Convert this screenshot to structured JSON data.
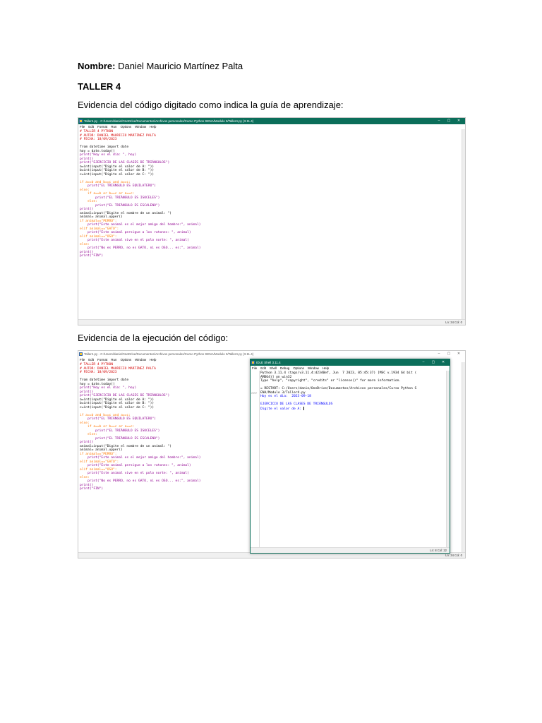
{
  "document": {
    "name_label": "Nombre:",
    "name_value": "Daniel Mauricio Martínez Palta",
    "taller": "TALLER 4",
    "evidence_code_heading": "Evidencia del código digitado como indica la guía de aprendizaje:",
    "evidence_exec_heading": "Evidencia de la ejecución del código:"
  },
  "editor": {
    "title": "Taller4.py - C:/Users/danie/OneDrive/Documentos/Archivos personales/Curso Python SENA/Modulo 3/Taller4.py (3.11.4)",
    "menu": [
      "File",
      "Edit",
      "Format",
      "Run",
      "Options",
      "Window",
      "Help"
    ],
    "status": "Ln: 34   Col: 0",
    "window_controls": [
      "–",
      "▢",
      "✕"
    ],
    "code_lines": [
      {
        "text": "# TALLER 4 PYTHON",
        "cls": "c-comment"
      },
      {
        "text": "# AUTOR: DANIEL MAURICIO MARTINEZ PALTA",
        "cls": "c-comment"
      },
      {
        "text": "# FECHA: 18/09/2023",
        "cls": "c-comment"
      },
      {
        "text": "",
        "cls": "c-def"
      },
      {
        "text": "from datetime import date",
        "cls": "c-def"
      },
      {
        "text": "hoy = date.today()",
        "cls": "c-def"
      },
      {
        "text": "print(\"Hoy es el dia: \", hoy)",
        "cls": "c-blt"
      },
      {
        "text": "print()",
        "cls": "c-blt"
      },
      {
        "text": "print(\"EJERCICIO DE LAS CLASES DE TRIÁNGULOS\")",
        "cls": "c-blt"
      },
      {
        "text": "a=int(input(\"Digite el valor de A: \"))",
        "cls": "c-def"
      },
      {
        "text": "b=int(input(\"Digite el valor de B: \"))",
        "cls": "c-def"
      },
      {
        "text": "c=int(input(\"Digite el valor de C: \"))",
        "cls": "c-def"
      },
      {
        "text": "",
        "cls": "c-def"
      },
      {
        "text": "if a==b and b==c and a==c:",
        "cls": "c-kw"
      },
      {
        "text": "    print(\"EL TRIÁNGULO ES EQUILATERO\")",
        "cls": "c-blt"
      },
      {
        "text": "else:",
        "cls": "c-kw"
      },
      {
        "text": "    if a==b or b==c or a==c:",
        "cls": "c-kw"
      },
      {
        "text": "        print(\"EL TRIÁNGULO ES ISOCELES\")",
        "cls": "c-blt"
      },
      {
        "text": "    else:",
        "cls": "c-kw"
      },
      {
        "text": "        print(\"EL TRIÁNGULO ES ESCALENO\")",
        "cls": "c-blt"
      },
      {
        "text": "print()",
        "cls": "c-blt"
      },
      {
        "text": "animal=input(\"Digite el nombre de un animal: \")",
        "cls": "c-def"
      },
      {
        "text": "animal= animal.upper()",
        "cls": "c-def"
      },
      {
        "text": "if animal==\"PERRO\":",
        "cls": "c-kw"
      },
      {
        "text": "    print(\"Este animal es el mejor amigo del hombre:\", animal)",
        "cls": "c-blt"
      },
      {
        "text": "elif animal==\"GATO\":",
        "cls": "c-kw"
      },
      {
        "text": "    print(\"Este animal persigue a los ratones: \", animal)",
        "cls": "c-blt"
      },
      {
        "text": "elif animal==\"OSO\":",
        "cls": "c-kw"
      },
      {
        "text": "    print(\"Este animal vive en el polo norte: \", animal)",
        "cls": "c-blt"
      },
      {
        "text": "else:",
        "cls": "c-kw"
      },
      {
        "text": "    print(\"No es PERRO, no es GATO, ni es OSO... es:\", animal)",
        "cls": "c-blt"
      },
      {
        "text": "print()",
        "cls": "c-blt"
      },
      {
        "text": "print(\"FIN\")",
        "cls": "c-blt"
      }
    ]
  },
  "shell": {
    "title": "IDLE Shell 3.11.4",
    "menu": [
      "File",
      "Edit",
      "Shell",
      "Debug",
      "Options",
      "Window",
      "Help"
    ],
    "status": "Ln: 8   Col: 22",
    "prompt": ">>>",
    "window_controls": [
      "–",
      "▢",
      "✕"
    ],
    "lines": [
      {
        "text": "Python 3.11.4 (tags/v3.11.4:d2340ef, Jun  7 2023, 05:45:37) [MSC v.1934 64 bit (",
        "cls": "c-def"
      },
      {
        "text": "AMD64)] on win32",
        "cls": "c-def"
      },
      {
        "text": "Type \"help\", \"copyright\", \"credits\" or \"license()\" for more information.",
        "cls": "c-def"
      },
      {
        "text": "",
        "cls": "c-def"
      },
      {
        "text": "= RESTART: C:/Users/danie/OneDrive/Documentos/Archivos personales/Curso Python S",
        "cls": "c-def"
      },
      {
        "text": "ENA/Modulo 3/Taller4.py",
        "cls": "c-def"
      },
      {
        "text": "Hoy es el dia:  2023-09-18",
        "cls": "c-out"
      },
      {
        "text": "",
        "cls": "c-def"
      },
      {
        "text": "EJERCICIO DE LAS CLASES DE TRIÁNGULOS",
        "cls": "c-out"
      },
      {
        "text": "Digite el valor de A: ",
        "cls": "c-out"
      }
    ]
  }
}
